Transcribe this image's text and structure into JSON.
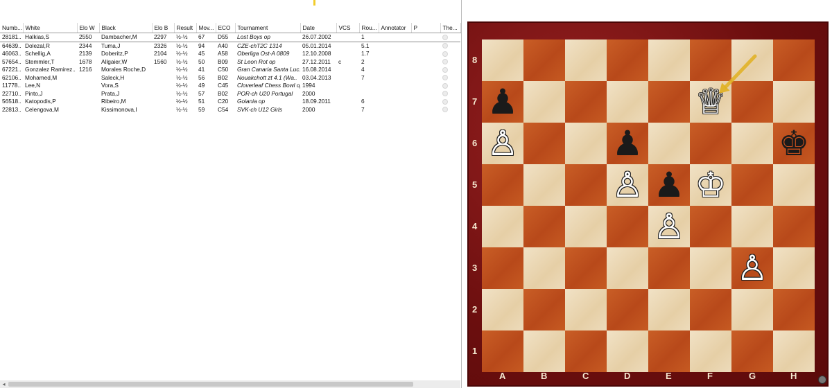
{
  "game_list": {
    "columns": [
      "Numb...",
      "White",
      "Elo W",
      "Black",
      "Elo B",
      "Result",
      "Mov...",
      "ECO",
      "Tournament",
      "Date",
      "VCS",
      "Rou...",
      "Annotator",
      "P",
      "The..."
    ],
    "rows": [
      [
        "28181..",
        "Halkias,S",
        "2550",
        "Dambacher,M",
        "2297",
        "½-½",
        "67",
        "D55",
        "Lost Boys op",
        "26.07.2002",
        "",
        "1",
        "",
        "",
        ""
      ],
      [
        "64639..",
        "Dolezal,R",
        "2344",
        "Tuma,J",
        "2326",
        "½-½",
        "94",
        "A40",
        "CZE-chT2C 1314",
        "05.01.2014",
        "",
        "5.1",
        "",
        "",
        ""
      ],
      [
        "46063..",
        "Schellig,A",
        "2139",
        "Doberitz,P",
        "2104",
        "½-½",
        "45",
        "A58",
        "Oberliga Ost-A 0809",
        "12.10.2008",
        "",
        "1.7",
        "",
        "",
        ""
      ],
      [
        "57654..",
        "Stemmler,T",
        "1678",
        "Allgaier,W",
        "1560",
        "½-½",
        "50",
        "B09",
        "St Leon Rot op",
        "27.12.2011",
        "c",
        "2",
        "",
        "",
        ""
      ],
      [
        "67221..",
        "Gonzalez Ramirez..",
        "1216",
        "Morales Roche,D",
        "",
        "½-½",
        "41",
        "C50",
        "Gran Canaria Santa Luc..",
        "16.08.2014",
        "",
        "4",
        "",
        "",
        ""
      ],
      [
        "62106..",
        "Mohamed,M",
        "",
        "Saleck,H",
        "",
        "½-½",
        "56",
        "B02",
        "Nouakchott zt 4.1 (Wa..",
        "03.04.2013",
        "",
        "7",
        "",
        "",
        ""
      ],
      [
        "11778..",
        "Lee,N",
        "",
        "Vora,S",
        "",
        "½-½",
        "49",
        "C45",
        "Cloverleaf Chess Bowl op",
        "1994",
        "",
        "",
        "",
        "",
        ""
      ],
      [
        "22710..",
        "Pinto,J",
        "",
        "Prata,J",
        "",
        "½-½",
        "57",
        "B02",
        "POR-ch U20 Portugal",
        "2000",
        "",
        "",
        "",
        "",
        ""
      ],
      [
        "56518..",
        "Katopodis,P",
        "",
        "Ribeiro,M",
        "",
        "½-½",
        "51",
        "C20",
        "Goiania op",
        "18.09.2011",
        "",
        "6",
        "",
        "",
        ""
      ],
      [
        "22813..",
        "Celengova,M",
        "",
        "Kissimonova,I",
        "",
        "½-½",
        "59",
        "C54",
        "SVK-ch U12 Girls",
        "2000",
        "",
        "7",
        "",
        "",
        ""
      ]
    ]
  },
  "board": {
    "files": [
      "A",
      "B",
      "C",
      "D",
      "E",
      "F",
      "G",
      "H"
    ],
    "ranks": [
      "8",
      "7",
      "6",
      "5",
      "4",
      "3",
      "2",
      "1"
    ],
    "pieces": [
      {
        "square": "a7",
        "color": "black",
        "type": "pawn",
        "glyph": "♟"
      },
      {
        "square": "f7",
        "color": "white",
        "type": "queen",
        "glyph": "♕"
      },
      {
        "square": "a6",
        "color": "white",
        "type": "pawn",
        "glyph": "♙"
      },
      {
        "square": "d6",
        "color": "black",
        "type": "pawn",
        "glyph": "♟"
      },
      {
        "square": "h6",
        "color": "black",
        "type": "king",
        "glyph": "♚"
      },
      {
        "square": "d5",
        "color": "white",
        "type": "pawn",
        "glyph": "♙"
      },
      {
        "square": "e5",
        "color": "black",
        "type": "pawn",
        "glyph": "♟"
      },
      {
        "square": "f5",
        "color": "white",
        "type": "king",
        "glyph": "♔"
      },
      {
        "square": "e4",
        "color": "white",
        "type": "pawn",
        "glyph": "♙"
      },
      {
        "square": "g3",
        "color": "white",
        "type": "pawn",
        "glyph": "♙"
      }
    ],
    "last_move_arrow": {
      "from": "g8",
      "to": "f7",
      "color": "#e0b020"
    },
    "colors": {
      "light": "#ecd9b8",
      "dark": "#c2551f",
      "frame": "#7a1212",
      "coords": "#f5e8d0"
    }
  }
}
